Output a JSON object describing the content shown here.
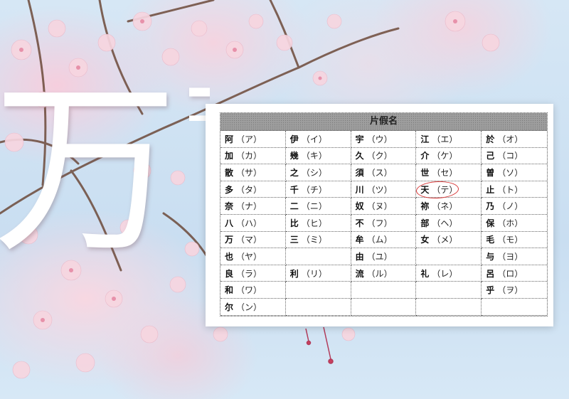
{
  "background": {
    "big_char": "万",
    "partial_char": "葉"
  },
  "table": {
    "title": "片假名",
    "rows": [
      [
        {
          "k": "阿",
          "r": "（ア）"
        },
        {
          "k": "伊",
          "r": "（イ）"
        },
        {
          "k": "宇",
          "r": "（ウ）"
        },
        {
          "k": "江",
          "r": "（エ）"
        },
        {
          "k": "於",
          "r": "（オ）"
        }
      ],
      [
        {
          "k": "加",
          "r": "（カ）"
        },
        {
          "k": "幾",
          "r": "（キ）"
        },
        {
          "k": "久",
          "r": "（ク）"
        },
        {
          "k": "介",
          "r": "（ケ）"
        },
        {
          "k": "己",
          "r": "（コ）"
        }
      ],
      [
        {
          "k": "散",
          "r": "（サ）"
        },
        {
          "k": "之",
          "r": "（シ）"
        },
        {
          "k": "須",
          "r": "（ス）"
        },
        {
          "k": "世",
          "r": "（セ）"
        },
        {
          "k": "曽",
          "r": "（ソ）"
        }
      ],
      [
        {
          "k": "多",
          "r": "（タ）"
        },
        {
          "k": "千",
          "r": "（チ）"
        },
        {
          "k": "川",
          "r": "（ツ）"
        },
        {
          "k": "天",
          "r": "（テ）"
        },
        {
          "k": "止",
          "r": "（ト）"
        }
      ],
      [
        {
          "k": "奈",
          "r": "（ナ）"
        },
        {
          "k": "二",
          "r": "（ニ）"
        },
        {
          "k": "奴",
          "r": "（ヌ）"
        },
        {
          "k": "祢",
          "r": "（ネ）"
        },
        {
          "k": "乃",
          "r": "（ノ）"
        }
      ],
      [
        {
          "k": "八",
          "r": "（ハ）"
        },
        {
          "k": "比",
          "r": "（ヒ）"
        },
        {
          "k": "不",
          "r": "（フ）"
        },
        {
          "k": "部",
          "r": "（ヘ）"
        },
        {
          "k": "保",
          "r": "（ホ）"
        }
      ],
      [
        {
          "k": "万",
          "r": "（マ）"
        },
        {
          "k": "三",
          "r": "（ミ）"
        },
        {
          "k": "牟",
          "r": "（ム）"
        },
        {
          "k": "女",
          "r": "（メ）"
        },
        {
          "k": "毛",
          "r": "（モ）"
        }
      ],
      [
        {
          "k": "也",
          "r": "（ヤ）"
        },
        {
          "k": "",
          "r": ""
        },
        {
          "k": "由",
          "r": "（ユ）"
        },
        {
          "k": "",
          "r": ""
        },
        {
          "k": "与",
          "r": "（ヨ）"
        }
      ],
      [
        {
          "k": "良",
          "r": "（ラ）"
        },
        {
          "k": "利",
          "r": "（リ）"
        },
        {
          "k": "流",
          "r": "（ル）"
        },
        {
          "k": "礼",
          "r": "（レ）"
        },
        {
          "k": "呂",
          "r": "（ロ）"
        }
      ],
      [
        {
          "k": "和",
          "r": "（ワ）"
        },
        {
          "k": "",
          "r": ""
        },
        {
          "k": "",
          "r": ""
        },
        {
          "k": "",
          "r": ""
        },
        {
          "k": "乎",
          "r": "（ヲ）"
        }
      ],
      [
        {
          "k": "尔",
          "r": "（ン）"
        },
        {
          "k": "",
          "r": ""
        },
        {
          "k": "",
          "r": ""
        },
        {
          "k": "",
          "r": ""
        },
        {
          "k": "",
          "r": ""
        }
      ]
    ],
    "highlighted": {
      "row": 3,
      "col": 3,
      "color": "#d83a3a"
    }
  },
  "colors": {
    "sky": "#cfe3f3",
    "blossom": "#f6d2dd",
    "highlight": "#d83a3a"
  }
}
